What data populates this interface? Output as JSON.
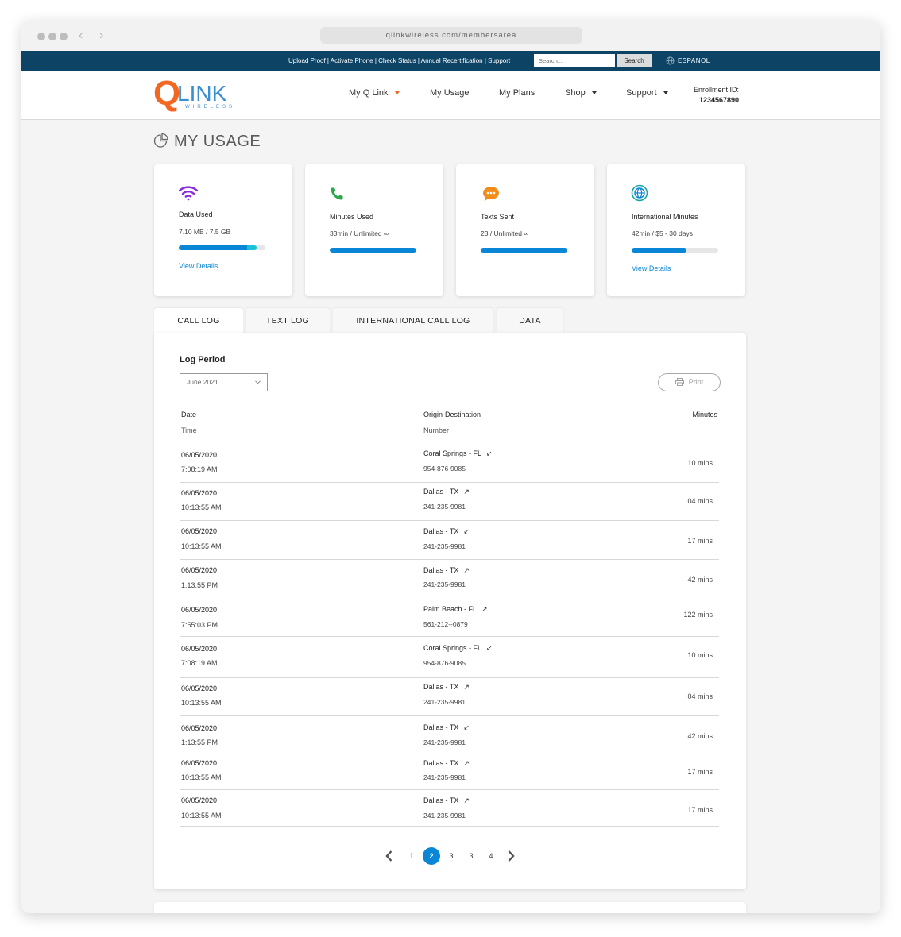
{
  "browser": {
    "url": "qlinkwireless.com/membersarea"
  },
  "utility_bar": {
    "links": "Upload Proof | Activate Phone | Check Status | Annual Recertification | Support",
    "search_placeholder": "Search...",
    "search_button": "Search",
    "language": "ESPANOL"
  },
  "logo": {
    "q": "Q",
    "link": "LINK",
    "wireless": "WIRELESS"
  },
  "nav": {
    "my_q_link": "My Q Link",
    "my_usage": "My Usage",
    "my_plans": "My Plans",
    "shop": "Shop",
    "support": "Support",
    "enrollment_label": "Enrollment ID:",
    "enrollment_id": "1234567890"
  },
  "page_title": "MY USAGE",
  "cards": [
    {
      "label": "Data Used",
      "value": "7.10 MB / 7.5 GB",
      "progress": 0.9,
      "link": "View Details"
    },
    {
      "label": "Minutes Used",
      "value": "33min / Unlimited ∞",
      "progress": 1.0
    },
    {
      "label": "Texts Sent",
      "value": "23 / Unlimited ∞",
      "progress": 1.0
    },
    {
      "label": "International Minutes",
      "value": "42min / $5 - 30 days",
      "progress": 0.63,
      "link": "View Details"
    }
  ],
  "tabs": [
    "CALL LOG",
    "TEXT LOG",
    "INTERNATIONAL CALL LOG",
    "DATA"
  ],
  "log": {
    "period_label": "Log Period",
    "period_value": "June 2021",
    "print_label": "Print",
    "headers": {
      "date": "Date",
      "time": "Time",
      "origin": "Origin-Destination",
      "number": "Number",
      "minutes": "Minutes"
    },
    "rows": [
      {
        "date": "06/05/2020",
        "time": "7:08:19 AM",
        "place": "Coral Springs - FL",
        "dir": "↙",
        "number": "954-876-9085",
        "minutes": "10 mins"
      },
      {
        "date": "06/05/2020",
        "time": "10:13:55 AM",
        "place": "Dallas - TX",
        "dir": "↗",
        "number": "241-235-9981",
        "minutes": "04 mins"
      },
      {
        "date": "06/05/2020",
        "time": "10:13:55 AM",
        "place": "Dallas - TX",
        "dir": "↙",
        "number": "241-235-9981",
        "minutes": "17 mins"
      },
      {
        "date": "06/05/2020",
        "time": "1:13:55 PM",
        "place": "Dallas - TX",
        "dir": "↗",
        "number": "241-235-9981",
        "minutes": "42 mins"
      },
      {
        "date": "06/05/2020",
        "time": "7:55:03 PM",
        "place": "Palm Beach - FL",
        "dir": "↗",
        "number": "561-212--0879",
        "minutes": "122 mins"
      },
      {
        "date": "06/05/2020",
        "time": "7:08:19 AM",
        "place": "Coral Springs - FL",
        "dir": "↙",
        "number": "954-876-9085",
        "minutes": "10 mins"
      },
      {
        "date": "06/05/2020",
        "time": "10:13:55 AM",
        "place": "Dallas - TX",
        "dir": "↗",
        "number": "241-235-9981",
        "minutes": "04 mins"
      },
      {
        "date": "06/05/2020",
        "time": "1:13:55 PM",
        "place": "Dallas - TX",
        "dir": "↙",
        "number": "241-235-9981",
        "minutes": "42 mins"
      },
      {
        "date": "06/05/2020",
        "time": "10:13:55 AM",
        "place": "Dallas - TX",
        "dir": "↗",
        "number": "241-235-9981",
        "minutes": "17 mins"
      },
      {
        "date": "06/05/2020",
        "time": "10:13:55 AM",
        "place": "Dallas - TX",
        "dir": "↗",
        "number": "241-235-9981",
        "minutes": "17 mins"
      }
    ]
  },
  "pagination": {
    "pages": [
      "1",
      "2",
      "3",
      "3",
      "4"
    ],
    "active_index": 1
  },
  "colors": {
    "primary": "#0a86d6",
    "utility_bar": "#0d4466",
    "brand_orange": "#f26722",
    "wifi": "#8a2be2",
    "phone": "#2ba84a",
    "chat": "#f28c1b",
    "globe": "#1aa5a0"
  }
}
